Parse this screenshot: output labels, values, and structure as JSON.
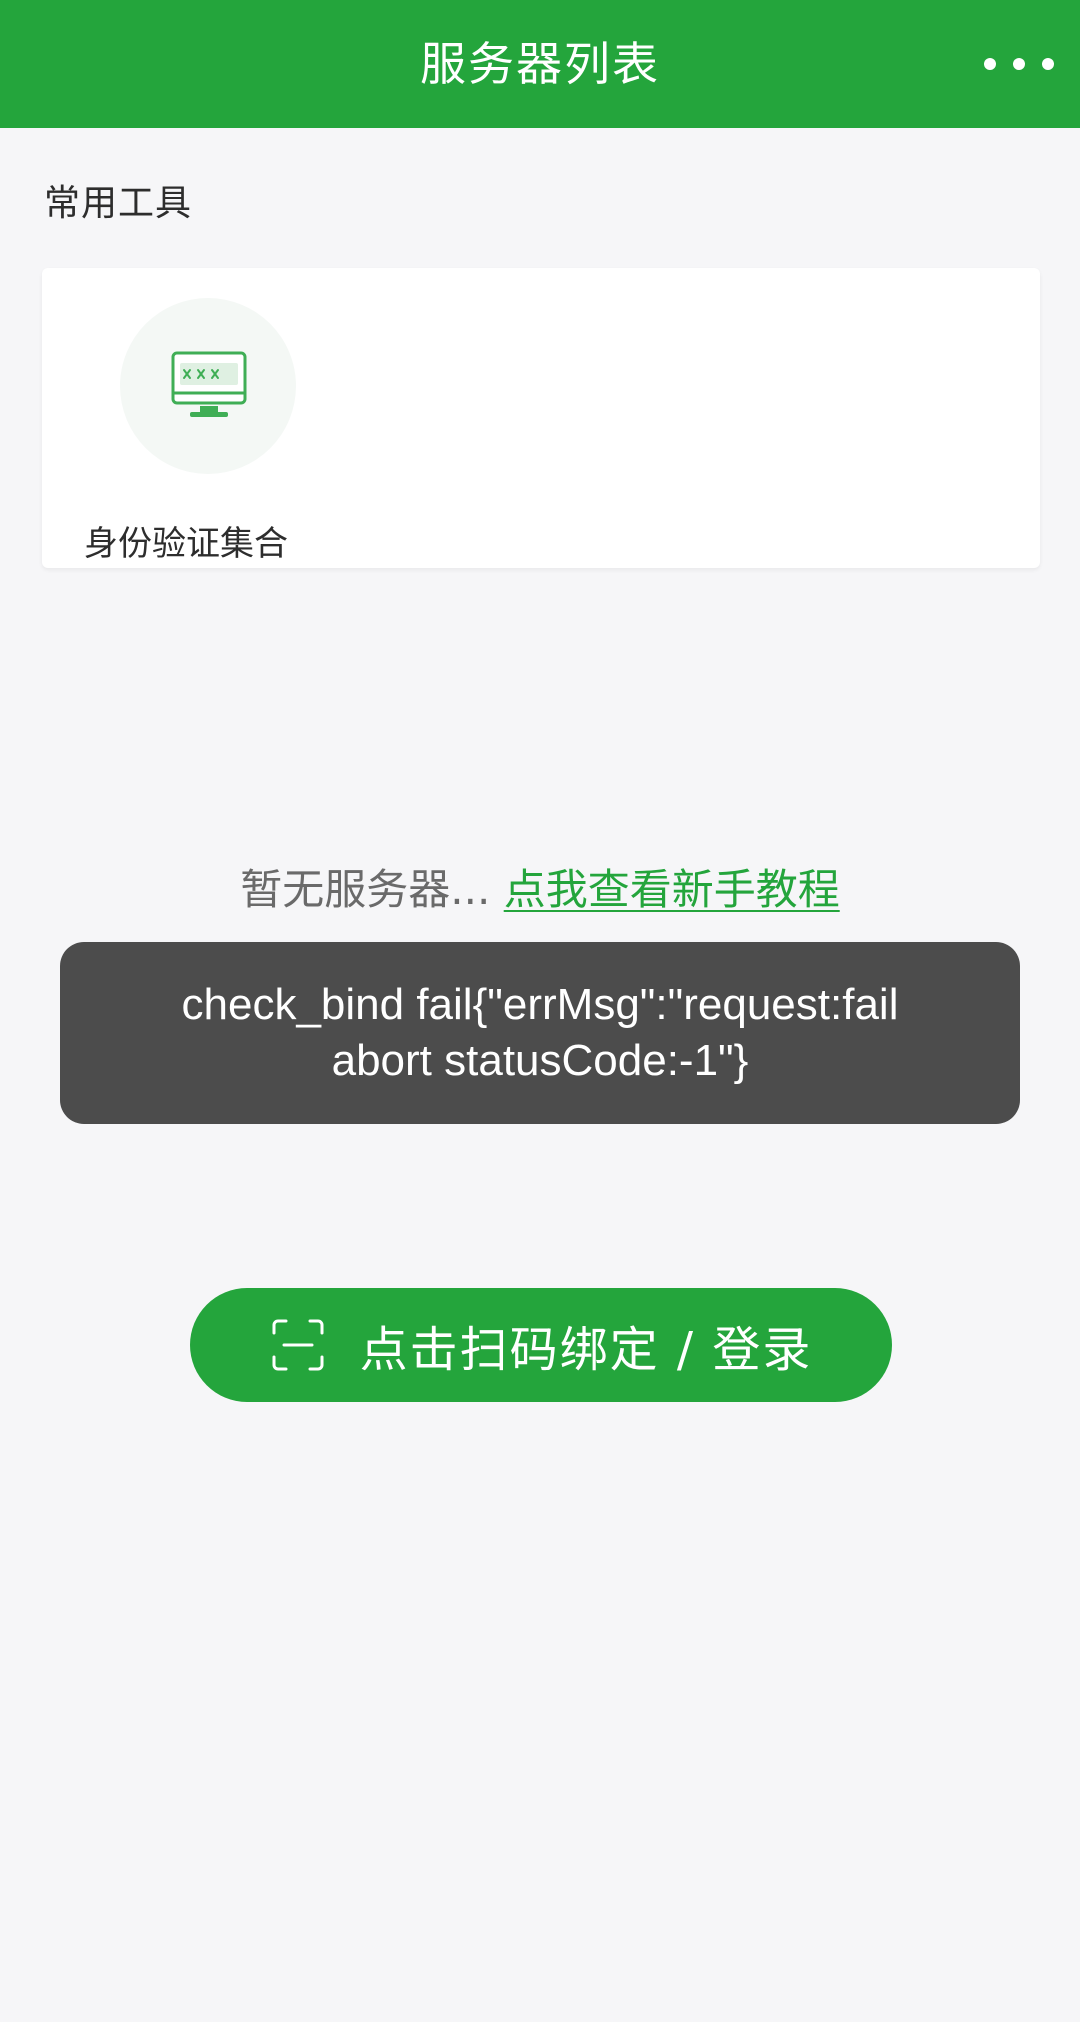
{
  "header": {
    "title": "服务器列表",
    "more_icon": "more-dots-icon",
    "bg_color": "#24a53c"
  },
  "tools_section": {
    "title": "常用工具",
    "items": [
      {
        "label": "身份验证集合",
        "icon": "monitor-password-icon"
      }
    ]
  },
  "empty_state": {
    "text": "暂无服务器...",
    "link": "点我查看新手教程"
  },
  "toast": {
    "message": "check_bind fail{\"errMsg\":\"request:fail abort statusCode:-1\"}"
  },
  "scan_button": {
    "label": "点击扫码绑定 / 登录",
    "icon": "scan-icon"
  },
  "colors": {
    "accent": "#24a53c",
    "background": "#f6f6f8",
    "toast_bg": "#4c4c4c"
  }
}
